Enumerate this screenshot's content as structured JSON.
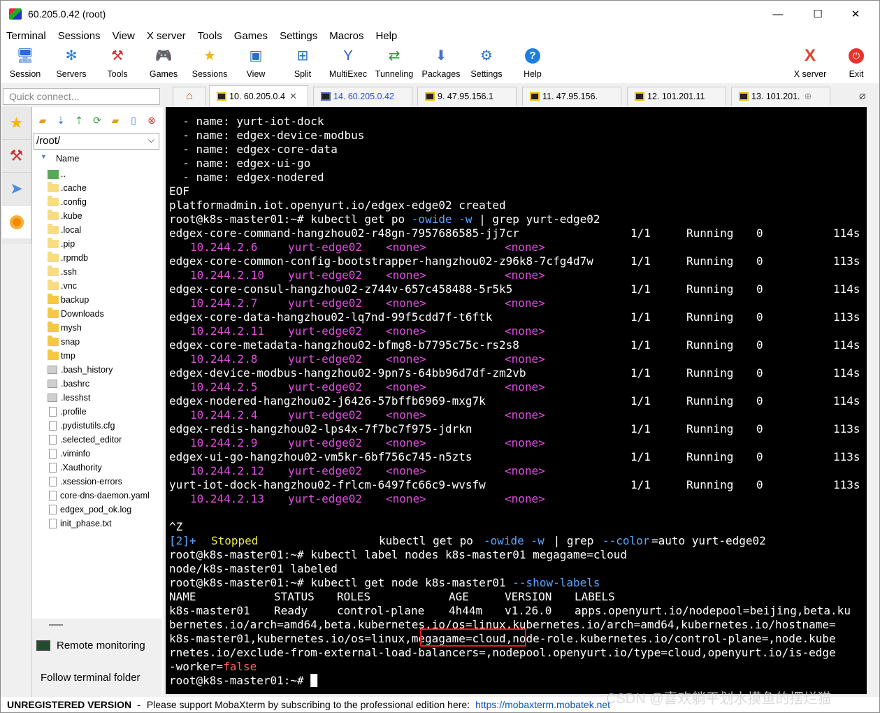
{
  "window": {
    "title": "60.205.0.42 (root)",
    "min": "—",
    "max": "☐",
    "close": "✕"
  },
  "menu": [
    "Terminal",
    "Sessions",
    "View",
    "X server",
    "Tools",
    "Games",
    "Settings",
    "Macros",
    "Help"
  ],
  "toolbar": [
    {
      "label": "Session",
      "icon": "session-icon"
    },
    {
      "label": "Servers",
      "icon": "servers-icon"
    },
    {
      "label": "Tools",
      "icon": "tools-icon"
    },
    {
      "label": "Games",
      "icon": "games-icon"
    },
    {
      "label": "Sessions",
      "icon": "star-icon"
    },
    {
      "label": "View",
      "icon": "view-icon"
    },
    {
      "label": "Split",
      "icon": "split-icon"
    },
    {
      "label": "MultiExec",
      "icon": "multiexec-icon"
    },
    {
      "label": "Tunneling",
      "icon": "tunneling-icon"
    },
    {
      "label": "Packages",
      "icon": "packages-icon"
    },
    {
      "label": "Settings",
      "icon": "settings-icon"
    },
    {
      "label": "Help",
      "icon": "help-icon"
    },
    {
      "label": "X server",
      "icon": "xserver-icon"
    },
    {
      "label": "Exit",
      "icon": "exit-icon"
    }
  ],
  "quick_connect": "Quick connect...",
  "tabs": [
    "10. 60.205.0.4",
    "14. 60.205.0.42",
    "9. 47.95.156.1",
    "11. 47.95.156.",
    "12. 101.201.11",
    "13. 101.201."
  ],
  "file_panel": {
    "path": "/root/",
    "column": "Name",
    "items": [
      "..",
      ".cache",
      ".config",
      ".kube",
      ".local",
      ".pip",
      ".rpmdb",
      ".ssh",
      ".vnc",
      "backup",
      "Downloads",
      "mysh",
      "snap",
      "tmp",
      ".bash_history",
      ".bashrc",
      ".lesshst",
      ".profile",
      ".pydistutils.cfg",
      ".selected_editor",
      ".viminfo",
      ".Xauthority",
      ".xsession-errors",
      "core-dns-daemon.yaml",
      "edgex_pod_ok.log",
      "init_phase.txt"
    ],
    "remote_monitoring": "Remote monitoring",
    "follow_folder": "Follow terminal folder"
  },
  "terminal": {
    "header_lines": [
      "  - name: yurt-iot-dock",
      "  - name: edgex-device-modbus",
      "  - name: edgex-core-data",
      "  - name: edgex-ui-go",
      "  - name: edgex-nodered",
      "EOF",
      "platformadmin.iot.openyurt.io/edgex-edge02 created"
    ],
    "prompt": "root@k8s-master01:~# ",
    "cmd1_a": "kubectl get po ",
    "cmd1_b": "-owide -w",
    " cmd1_c": "",
    "cmd1_pipe": " | grep yurt-edge02",
    "pods": [
      {
        "name": "edgex-core-command-hangzhou02-r48gn-7957686585-jj7cr",
        "ready": "1/1",
        "status": "Running",
        "restarts": "0",
        "age": "114s",
        "ip": "10.244.2.6"
      },
      {
        "name": "edgex-core-common-config-bootstrapper-hangzhou02-z96k8-7cfg4d7w",
        "ready": "1/1",
        "status": "Running",
        "restarts": "0",
        "age": "113s",
        "ip": "10.244.2.10"
      },
      {
        "name": "edgex-core-consul-hangzhou02-z744v-657c458488-5r5k5",
        "ready": "1/1",
        "status": "Running",
        "restarts": "0",
        "age": "114s",
        "ip": "10.244.2.7"
      },
      {
        "name": "edgex-core-data-hangzhou02-lq7nd-99f5cdd7f-t6ftk",
        "ready": "1/1",
        "status": "Running",
        "restarts": "0",
        "age": "113s",
        "ip": "10.244.2.11"
      },
      {
        "name": "edgex-core-metadata-hangzhou02-bfmg8-b7795c75c-rs2s8",
        "ready": "1/1",
        "status": "Running",
        "restarts": "0",
        "age": "114s",
        "ip": "10.244.2.8"
      },
      {
        "name": "edgex-device-modbus-hangzhou02-9pn7s-64bb96d7df-zm2vb",
        "ready": "1/1",
        "status": "Running",
        "restarts": "0",
        "age": "114s",
        "ip": "10.244.2.5"
      },
      {
        "name": "edgex-nodered-hangzhou02-j6426-57bffb6969-mxg7k",
        "ready": "1/1",
        "status": "Running",
        "restarts": "0",
        "age": "114s",
        "ip": "10.244.2.4"
      },
      {
        "name": "edgex-redis-hangzhou02-lps4x-7f7bc7f975-jdrkn",
        "ready": "1/1",
        "status": "Running",
        "restarts": "0",
        "age": "113s",
        "ip": "10.244.2.9"
      },
      {
        "name": "edgex-ui-go-hangzhou02-vm5kr-6bf756c745-n5zts",
        "ready": "1/1",
        "status": "Running",
        "restarts": "0",
        "age": "113s",
        "ip": "10.244.2.12"
      },
      {
        "name": "yurt-iot-dock-hangzhou02-frlcm-6497fc66c9-wvsfw",
        "ready": "1/1",
        "status": "Running",
        "restarts": "0",
        "age": "113s",
        "ip": "10.244.2.13"
      }
    ],
    "node": "yurt-edge02",
    "none": "<none>",
    "ctrlz": "^Z",
    "job": "[2]+",
    "stopped": "Stopped",
    "job_cmd_a": "kubectl get po ",
    "job_cmd_b": "-owide -w",
    "job_cmd_c": " | grep ",
    "job_cmd_d": "--color",
    "job_cmd_e": "=auto yurt-edge02",
    "cmd2": "kubectl label nodes k8s-master01 megagame=cloud",
    "labeled": "node/k8s-master01 labeled",
    "cmd3_a": "kubectl get node k8s-master01 ",
    "cmd3_b": "--show-labels",
    "headers": {
      "name": "NAME",
      "status": "STATUS",
      "roles": "ROLES",
      "age": "AGE",
      "version": "VERSION",
      "labels": "LABELS"
    },
    "node_row": {
      "name": "k8s-master01",
      "status": "Ready",
      "roles": "control-plane",
      "age": "4h44m",
      "version": "v1.26.0",
      "labels_start": "apps.openyurt.io/nodepool=beijing,beta.ku"
    },
    "wrap1": "bernetes.io/arch=amd64,beta.kubernetes.io/os=linux,kubernetes.io/arch=amd64,kubernetes.io/hostname=",
    "wrap2": "k8s-master01,kubernetes.io/os=linux,megagame=cloud,node-role.kubernetes.io/control-plane=,node.kube",
    "wrap3": "rnetes.io/exclude-from-external-load-balancers=,nodepool.openyurt.io/type=cloud,openyurt.io/is-edge",
    "wrap4_a": "-worker=",
    "wrap4_b": "false",
    "cursor": "█"
  },
  "status": {
    "unregistered": "UNREGISTERED VERSION",
    "dash": "-",
    "message": "Please support MobaXterm by subscribing to the professional edition here:",
    "link": "https://mobaxterm.mobatek.net"
  },
  "watermark": "CSDN @喜欢躺平划水摸鱼的摆烂猫"
}
